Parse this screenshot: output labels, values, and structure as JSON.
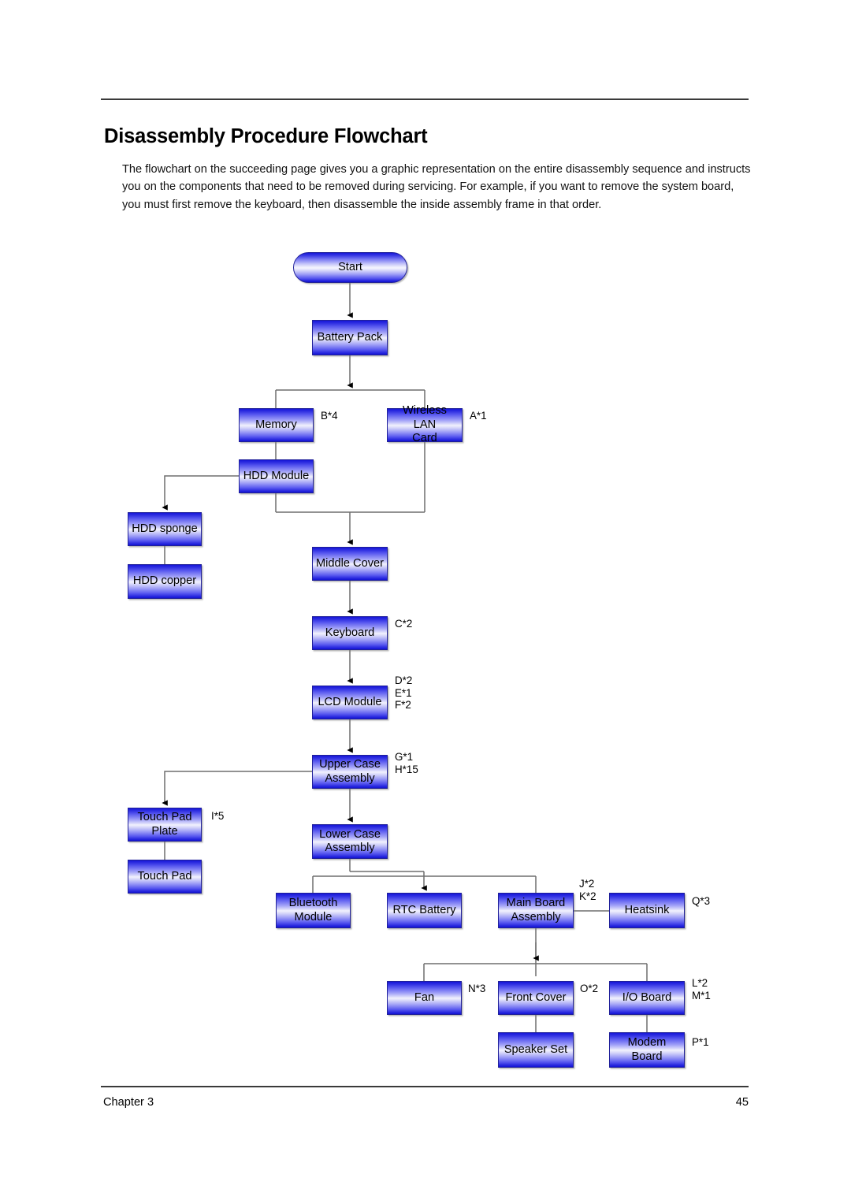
{
  "document": {
    "title": "Disassembly Procedure Flowchart",
    "intro": "The flowchart on the succeeding page gives you a graphic representation on the entire disassembly sequence and instructs you on the components that need to be removed during servicing. For example, if you want to remove the system board, you must first remove the keyboard, then disassemble the inside assembly frame in that order.",
    "footer": {
      "chapter": "Chapter 3",
      "page_number": "45"
    }
  },
  "chart_data": {
    "type": "diagram",
    "title": "Disassembly Procedure Flowchart",
    "nodes": [
      {
        "id": "start",
        "label": "Start",
        "shape": "terminator",
        "tag": ""
      },
      {
        "id": "battery",
        "label": "Battery Pack",
        "shape": "process",
        "tag": ""
      },
      {
        "id": "memory",
        "label": "Memory",
        "shape": "process",
        "tag": "B*4"
      },
      {
        "id": "wlan",
        "label": "Wireless LAN\nCard",
        "shape": "process",
        "tag": "A*1"
      },
      {
        "id": "hddmodule",
        "label": "HDD Module",
        "shape": "process",
        "tag": ""
      },
      {
        "id": "hddsponge",
        "label": "HDD sponge",
        "shape": "process",
        "tag": ""
      },
      {
        "id": "hddcopper",
        "label": "HDD copper",
        "shape": "process",
        "tag": ""
      },
      {
        "id": "middlecover",
        "label": "Middle Cover",
        "shape": "process",
        "tag": ""
      },
      {
        "id": "keyboard",
        "label": "Keyboard",
        "shape": "process",
        "tag": "C*2"
      },
      {
        "id": "lcdmodule",
        "label": "LCD Module",
        "shape": "process",
        "tag": "D*2\nE*1\nF*2"
      },
      {
        "id": "uppercase",
        "label": "Upper Case\nAssembly",
        "shape": "process",
        "tag": "G*1\nH*15"
      },
      {
        "id": "touchpadplate",
        "label": "Touch Pad\nPlate",
        "shape": "process",
        "tag": "I*5"
      },
      {
        "id": "touchpad",
        "label": "Touch Pad",
        "shape": "process",
        "tag": ""
      },
      {
        "id": "lowercase",
        "label": "Lower Case\nAssembly",
        "shape": "process",
        "tag": ""
      },
      {
        "id": "bluetooth",
        "label": "Bluetooth\nModule",
        "shape": "process",
        "tag": ""
      },
      {
        "id": "rtcbattery",
        "label": "RTC Battery",
        "shape": "process",
        "tag": ""
      },
      {
        "id": "mainboard",
        "label": "Main Board\nAssembly",
        "shape": "process",
        "tag": "J*2\nK*2"
      },
      {
        "id": "heatsink",
        "label": "Heatsink",
        "shape": "process",
        "tag": "Q*3"
      },
      {
        "id": "fan",
        "label": "Fan",
        "shape": "process",
        "tag": "N*3"
      },
      {
        "id": "frontcover",
        "label": "Front Cover",
        "shape": "process",
        "tag": "O*2"
      },
      {
        "id": "ioboard",
        "label": "I/O Board",
        "shape": "process",
        "tag": "L*2\nM*1"
      },
      {
        "id": "speakerset",
        "label": "Speaker Set",
        "shape": "process",
        "tag": ""
      },
      {
        "id": "modemboard",
        "label": "Modem\nBoard",
        "shape": "process",
        "tag": "P*1"
      }
    ],
    "edges": [
      {
        "from": "start",
        "to": "battery",
        "arrow": true
      },
      {
        "from": "battery",
        "to": "memory",
        "arrow": false
      },
      {
        "from": "battery",
        "to": "wlan",
        "arrow": false
      },
      {
        "from": "memory",
        "to": "hddmodule",
        "arrow": false
      },
      {
        "from": "hddmodule",
        "to": "hddsponge",
        "arrow": true
      },
      {
        "from": "hddsponge",
        "to": "hddcopper",
        "arrow": false
      },
      {
        "from": "hddmodule",
        "to": "middlecover",
        "arrow": true
      },
      {
        "from": "wlan",
        "to": "middlecover",
        "arrow": true
      },
      {
        "from": "middlecover",
        "to": "keyboard",
        "arrow": true
      },
      {
        "from": "keyboard",
        "to": "lcdmodule",
        "arrow": true
      },
      {
        "from": "lcdmodule",
        "to": "uppercase",
        "arrow": true
      },
      {
        "from": "uppercase",
        "to": "touchpadplate",
        "arrow": true
      },
      {
        "from": "touchpadplate",
        "to": "touchpad",
        "arrow": false
      },
      {
        "from": "uppercase",
        "to": "lowercase",
        "arrow": true
      },
      {
        "from": "lowercase",
        "to": "bluetooth",
        "arrow": false
      },
      {
        "from": "lowercase",
        "to": "rtcbattery",
        "arrow": false
      },
      {
        "from": "lowercase",
        "to": "mainboard",
        "arrow": false
      },
      {
        "from": "mainboard",
        "to": "heatsink",
        "arrow": false
      },
      {
        "from": "mainboard",
        "to": "fan",
        "arrow": false
      },
      {
        "from": "mainboard",
        "to": "frontcover",
        "arrow": false
      },
      {
        "from": "mainboard",
        "to": "ioboard",
        "arrow": false
      },
      {
        "from": "frontcover",
        "to": "speakerset",
        "arrow": false
      },
      {
        "from": "ioboard",
        "to": "modemboard",
        "arrow": false
      }
    ]
  }
}
